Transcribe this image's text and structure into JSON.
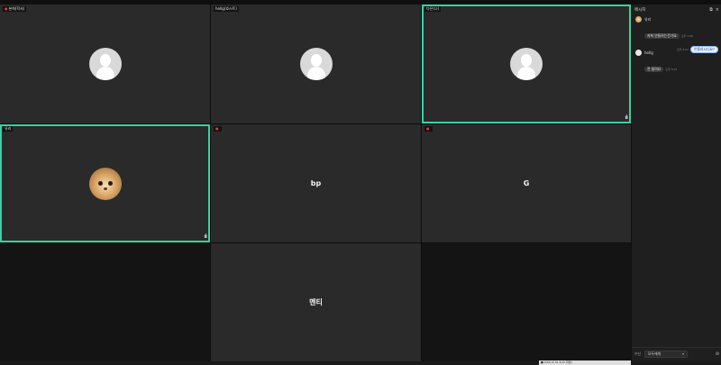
{
  "tiles": [
    {
      "label": "본희(학사)",
      "muted": true,
      "kind": "placeholder"
    },
    {
      "label": "hellg(호스트)",
      "muted": false,
      "kind": "placeholder"
    },
    {
      "label": "다은(나)",
      "muted": false,
      "kind": "placeholder",
      "speaking": true
    },
    {
      "label": "유리",
      "muted": false,
      "kind": "cat",
      "speaking": true
    },
    {
      "label": "",
      "muted": true,
      "kind": "name",
      "name": "bp"
    },
    {
      "label": "",
      "muted": true,
      "kind": "name",
      "name": "G"
    },
    {
      "kind": "empty"
    },
    {
      "label": "",
      "muted": false,
      "kind": "name",
      "name": "멘티"
    },
    {
      "kind": "empty"
    }
  ],
  "icons": {
    "mute": "●",
    "speaking": "ıılı",
    "popout": "⧉",
    "close": "×",
    "chevron": "▾",
    "attach": "⊘"
  },
  "chat": {
    "title": "메시지",
    "messages": [
      {
        "sender": "유리",
        "text": "저희 안들려는건가요",
        "time": "오후 3:06",
        "mine": false
      },
      {
        "sender": "",
        "text": "안들리시나요?",
        "time": "오후 3:07",
        "mine": true
      },
      {
        "sender": "hellg",
        "text": "전 들려요",
        "time": "오후 3:07",
        "mine": false
      }
    ],
    "receiver_label": "수신",
    "receiver_value": "모두에게"
  },
  "taskbar_text": "■ 4/18 (3:31 2/15 화면)"
}
